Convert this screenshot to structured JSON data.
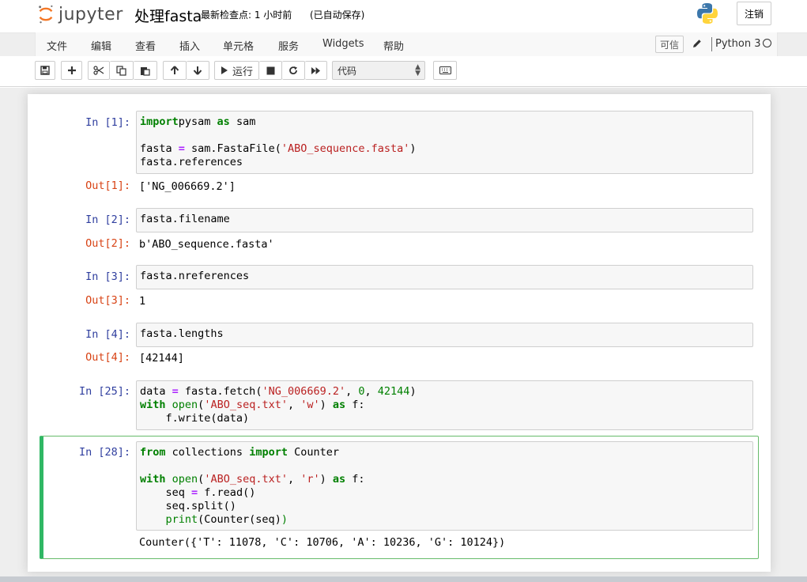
{
  "header": {
    "logo_text": "jupyter",
    "notebook_name": "处理fasta",
    "checkpoint": "最新检查点: 1 小时前",
    "autosave": "(已自动保存)",
    "logout": "注销"
  },
  "menu": {
    "items": [
      "文件",
      "编辑",
      "查看",
      "插入",
      "单元格",
      "服务",
      "Widgets",
      "帮助"
    ],
    "trusted": "可信",
    "kernel": "Python 3"
  },
  "toolbar": {
    "run_label": "运行",
    "cell_type": "代码",
    "icons": [
      "save-icon",
      "plus-icon",
      "cut-icon",
      "copy-icon",
      "paste-icon",
      "arrow-up-icon",
      "arrow-down-icon",
      "run-icon",
      "stop-icon",
      "restart-icon",
      "fast-forward-icon",
      "keyboard-icon"
    ]
  },
  "cells": [
    {
      "in_prompt": "In [1]:",
      "out_prompt": "Out[1]:",
      "code_lines": [
        [
          [
            "kw",
            "import"
          ],
          [
            "",
            "pysam"
          ],
          [
            "kw",
            " as"
          ],
          [
            "",
            " sam"
          ]
        ],
        [],
        [
          [
            "",
            "fasta "
          ],
          [
            "op",
            "="
          ],
          [
            "",
            " sam.FastaFile("
          ],
          [
            "str",
            "'ABO_sequence.fasta'"
          ],
          [
            "",
            ")"
          ]
        ],
        [
          [
            "",
            "fasta.references"
          ]
        ]
      ],
      "output": "['NG_006669.2']"
    },
    {
      "in_prompt": "In [2]:",
      "out_prompt": "Out[2]:",
      "code_lines": [
        [
          [
            "",
            "fasta.filename"
          ]
        ]
      ],
      "output": "b'ABO_sequence.fasta'"
    },
    {
      "in_prompt": "In [3]:",
      "out_prompt": "Out[3]:",
      "code_lines": [
        [
          [
            "",
            "fasta.nreferences"
          ]
        ]
      ],
      "output": "1"
    },
    {
      "in_prompt": "In [4]:",
      "out_prompt": "Out[4]:",
      "code_lines": [
        [
          [
            "",
            "fasta.lengths"
          ]
        ]
      ],
      "output": "[42144]"
    },
    {
      "in_prompt": "In [25]:",
      "out_prompt": "",
      "code_lines": [
        [
          [
            "",
            "data "
          ],
          [
            "op",
            "="
          ],
          [
            "",
            " fasta.fetch("
          ],
          [
            "str",
            "'NG_006669.2'"
          ],
          [
            "",
            ", "
          ],
          [
            "num",
            "0"
          ],
          [
            "",
            ", "
          ],
          [
            "num",
            "42144"
          ],
          [
            "",
            ")"
          ]
        ],
        [
          [
            "kw",
            "with"
          ],
          [
            "",
            " "
          ],
          [
            "bi",
            "open"
          ],
          [
            "",
            "("
          ],
          [
            "str",
            "'ABO_seq.txt'"
          ],
          [
            "",
            ", "
          ],
          [
            "str",
            "'w'"
          ],
          [
            "",
            ") "
          ],
          [
            "kw",
            "as"
          ],
          [
            "",
            " f:"
          ]
        ],
        [
          [
            "",
            "    f.write(data)"
          ]
        ]
      ],
      "output": ""
    },
    {
      "in_prompt": "In [28]:",
      "out_prompt": "",
      "code_lines": [
        [
          [
            "kw",
            "from"
          ],
          [
            "",
            " collections "
          ],
          [
            "kw",
            "import"
          ],
          [
            "",
            " Counter"
          ]
        ],
        [],
        [
          [
            "kw",
            "with"
          ],
          [
            "",
            " "
          ],
          [
            "bi",
            "open"
          ],
          [
            "",
            "("
          ],
          [
            "str",
            "'ABO_seq.txt'"
          ],
          [
            "",
            ", "
          ],
          [
            "str",
            "'r'"
          ],
          [
            "",
            ") "
          ],
          [
            "kw",
            "as"
          ],
          [
            "",
            " f:"
          ]
        ],
        [
          [
            "",
            "    seq "
          ],
          [
            "op",
            "="
          ],
          [
            "",
            " f.read()"
          ]
        ],
        [
          [
            "",
            "    seq.split()"
          ]
        ],
        [
          [
            "",
            "    "
          ],
          [
            "bi",
            "print"
          ],
          [
            "",
            "(Counter(seq)"
          ],
          [
            "bi",
            ")"
          ]
        ]
      ],
      "output": "Counter({'T': 11078, 'C': 10706, 'A': 10236, 'G': 10124})"
    }
  ]
}
